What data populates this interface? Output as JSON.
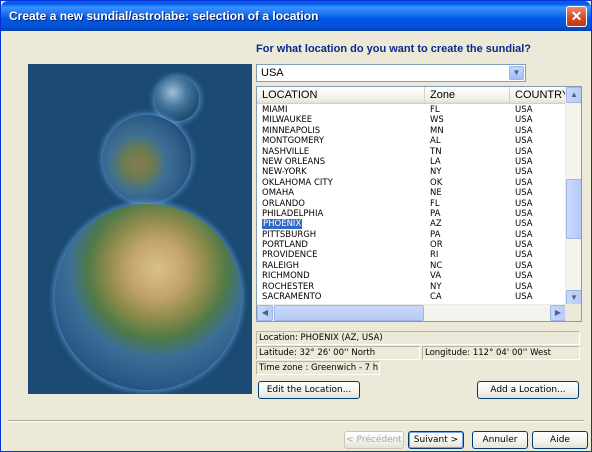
{
  "window": {
    "title": "Create a new sundial/astrolabe: selection of a location",
    "close_glyph": "✕"
  },
  "question": "For what location do you want to create the sundial?",
  "country_select": {
    "value": "USA"
  },
  "list": {
    "columns": [
      "LOCATION",
      "Zone",
      "COUNTRY"
    ],
    "rows": [
      [
        "MIAMI",
        "FL",
        "USA"
      ],
      [
        "MILWAUKEE",
        "WS",
        "USA"
      ],
      [
        "MINNEAPOLIS",
        "MN",
        "USA"
      ],
      [
        "MONTGOMERY",
        "AL",
        "USA"
      ],
      [
        "NASHVILLE",
        "TN",
        "USA"
      ],
      [
        "NEW ORLEANS",
        "LA",
        "USA"
      ],
      [
        "NEW-YORK",
        "NY",
        "USA"
      ],
      [
        "OKLAHOMA CITY",
        "OK",
        "USA"
      ],
      [
        "OMAHA",
        "NE",
        "USA"
      ],
      [
        "ORLANDO",
        "FL",
        "USA"
      ],
      [
        "PHILADELPHIA",
        "PA",
        "USA"
      ],
      [
        "PHOENIX",
        "AZ",
        "USA"
      ],
      [
        "PITTSBURGH",
        "PA",
        "USA"
      ],
      [
        "PORTLAND",
        "OR",
        "USA"
      ],
      [
        "PROVIDENCE",
        "RI",
        "USA"
      ],
      [
        "RALEIGH",
        "NC",
        "USA"
      ],
      [
        "RICHMOND",
        "VA",
        "USA"
      ],
      [
        "ROCHESTER",
        "NY",
        "USA"
      ],
      [
        "SACRAMENTO",
        "CA",
        "USA"
      ]
    ],
    "selected_index": 11
  },
  "info": {
    "location": "Location:  PHOENIX (AZ, USA)",
    "latitude": "Latitude:  32° 26' 00'' North",
    "longitude": "Longitude:  112° 04' 00'' West",
    "timezone": "Time zone : Greenwich - 7 h"
  },
  "buttons": {
    "edit": "Edit the Location...",
    "add": "Add a Location...",
    "prev": "< Précédent",
    "next": "Suivant >",
    "cancel": "Annuler",
    "help": "Aide"
  },
  "colors": {
    "titlebar": "#0058e8",
    "selection": "#316ac5",
    "question": "#0a2a8a",
    "globe_panel": "#1b4a72"
  },
  "icons": {
    "dropdown": "chevron-down-icon",
    "scroll_up": "arrow-up-icon",
    "scroll_down": "arrow-down-icon",
    "scroll_left": "arrow-left-icon",
    "scroll_right": "arrow-right-icon"
  }
}
